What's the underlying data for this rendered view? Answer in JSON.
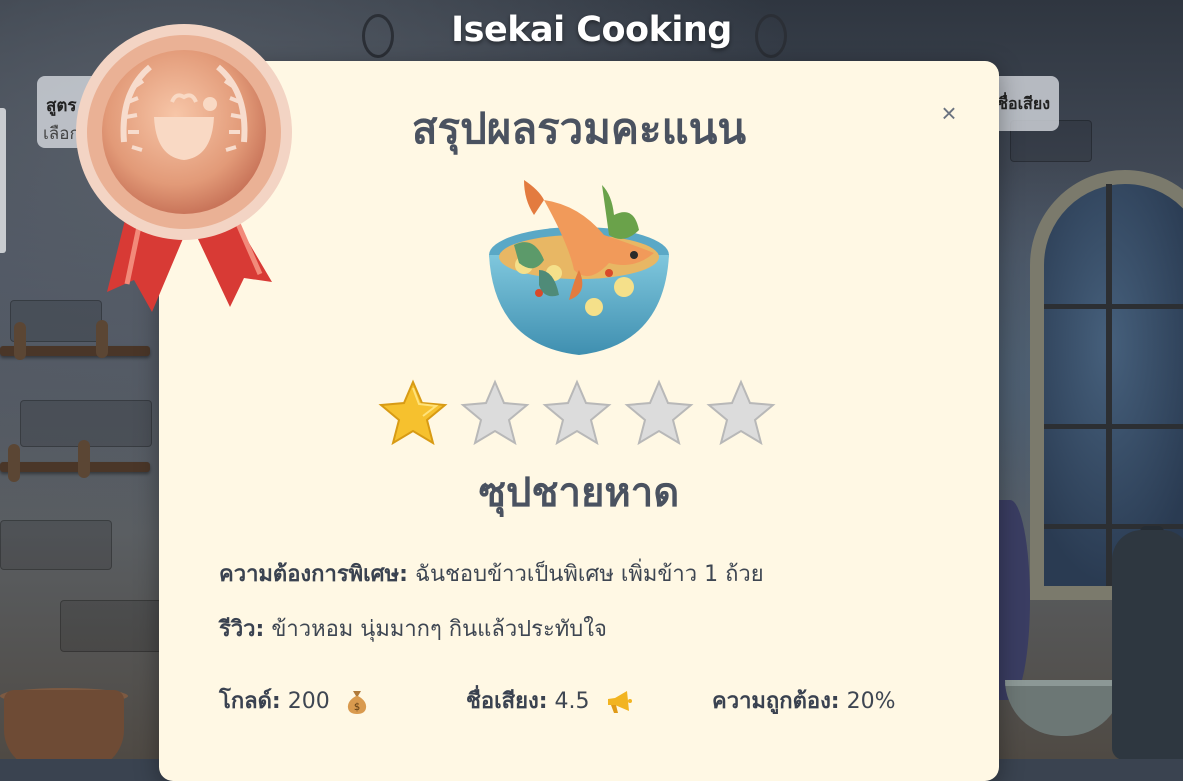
{
  "header": {
    "game_title": "Isekai Cooking"
  },
  "side_left": {
    "line1": "สูตร",
    "line2": "เลือก"
  },
  "side_right": {
    "line1": "ชื่อเสียง"
  },
  "modal": {
    "title": "สรุปผลรวมคะแนน",
    "close_label": "×",
    "dish_name": "ซุปชายหาด",
    "rating": {
      "value": 1,
      "max": 5
    },
    "special_request_label": "ความต้องการพิเศษ:",
    "special_request_text": "ฉันชอบข้าวเป็นพิเศษ เพิ่มข้าว 1 ถ้วย",
    "review_label": "รีวิว:",
    "review_text": "ข้าวหอม นุ่มมากๆ กินแล้วประทับใจ",
    "stats": {
      "gold_label": "โกลด์:",
      "gold_value": "200",
      "reputation_label": "ชื่อเสียง:",
      "reputation_value": "4.5",
      "accuracy_label": "ความถูกต้อง:",
      "accuracy_value": "20%"
    },
    "medal": "bronze",
    "icons": [
      "bronze-medal-icon",
      "fish-soup-bowl-icon",
      "star-icon",
      "money-bag-icon",
      "megaphone-icon",
      "close-icon"
    ]
  },
  "colors": {
    "modal_background": "#fff8e4",
    "text_dark": "#4a5260",
    "star_filled": "#f6c12e",
    "star_empty": "#d6d6d6",
    "medal_bronze": "#e8a585",
    "ribbon_red": "#d83a35"
  }
}
